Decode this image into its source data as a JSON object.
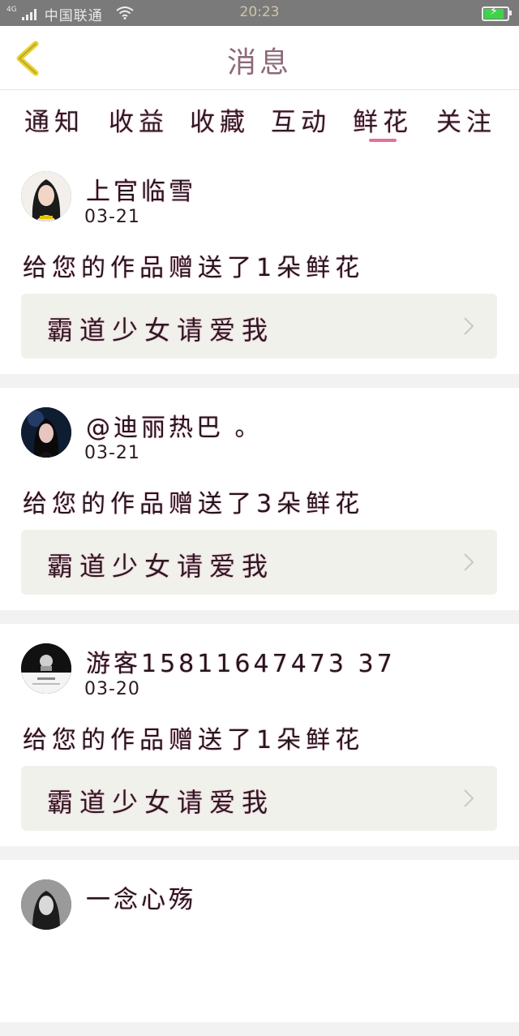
{
  "status_bar": {
    "network": "4G",
    "carrier": "中国联通",
    "time": "20:23",
    "battery_color": "#3fd34a"
  },
  "header": {
    "title": "消息",
    "back_icon": "chevron-left-icon",
    "accent_color": "#e8d12f"
  },
  "tabs": [
    {
      "label": "通知"
    },
    {
      "label": "收益"
    },
    {
      "label": "收藏"
    },
    {
      "label": "互动"
    },
    {
      "label": "鲜花",
      "selected": true
    },
    {
      "label": "关注"
    }
  ],
  "messages": [
    {
      "name": "上官临雪",
      "date": "03-21",
      "text": "给您的作品赠送了1朵鲜花",
      "work_title": "霸道少女请爱我"
    },
    {
      "name": "@迪丽热巴 。",
      "date": "03-21",
      "text": "给您的作品赠送了3朵鲜花",
      "work_title": "霸道少女请爱我"
    },
    {
      "name": "游客15811647473 37",
      "date": "03-20",
      "text": "给您的作品赠送了1朵鲜花",
      "work_title": "霸道少女请爱我"
    },
    {
      "name": "一念心殇",
      "date": "",
      "text": "",
      "work_title": ""
    }
  ]
}
